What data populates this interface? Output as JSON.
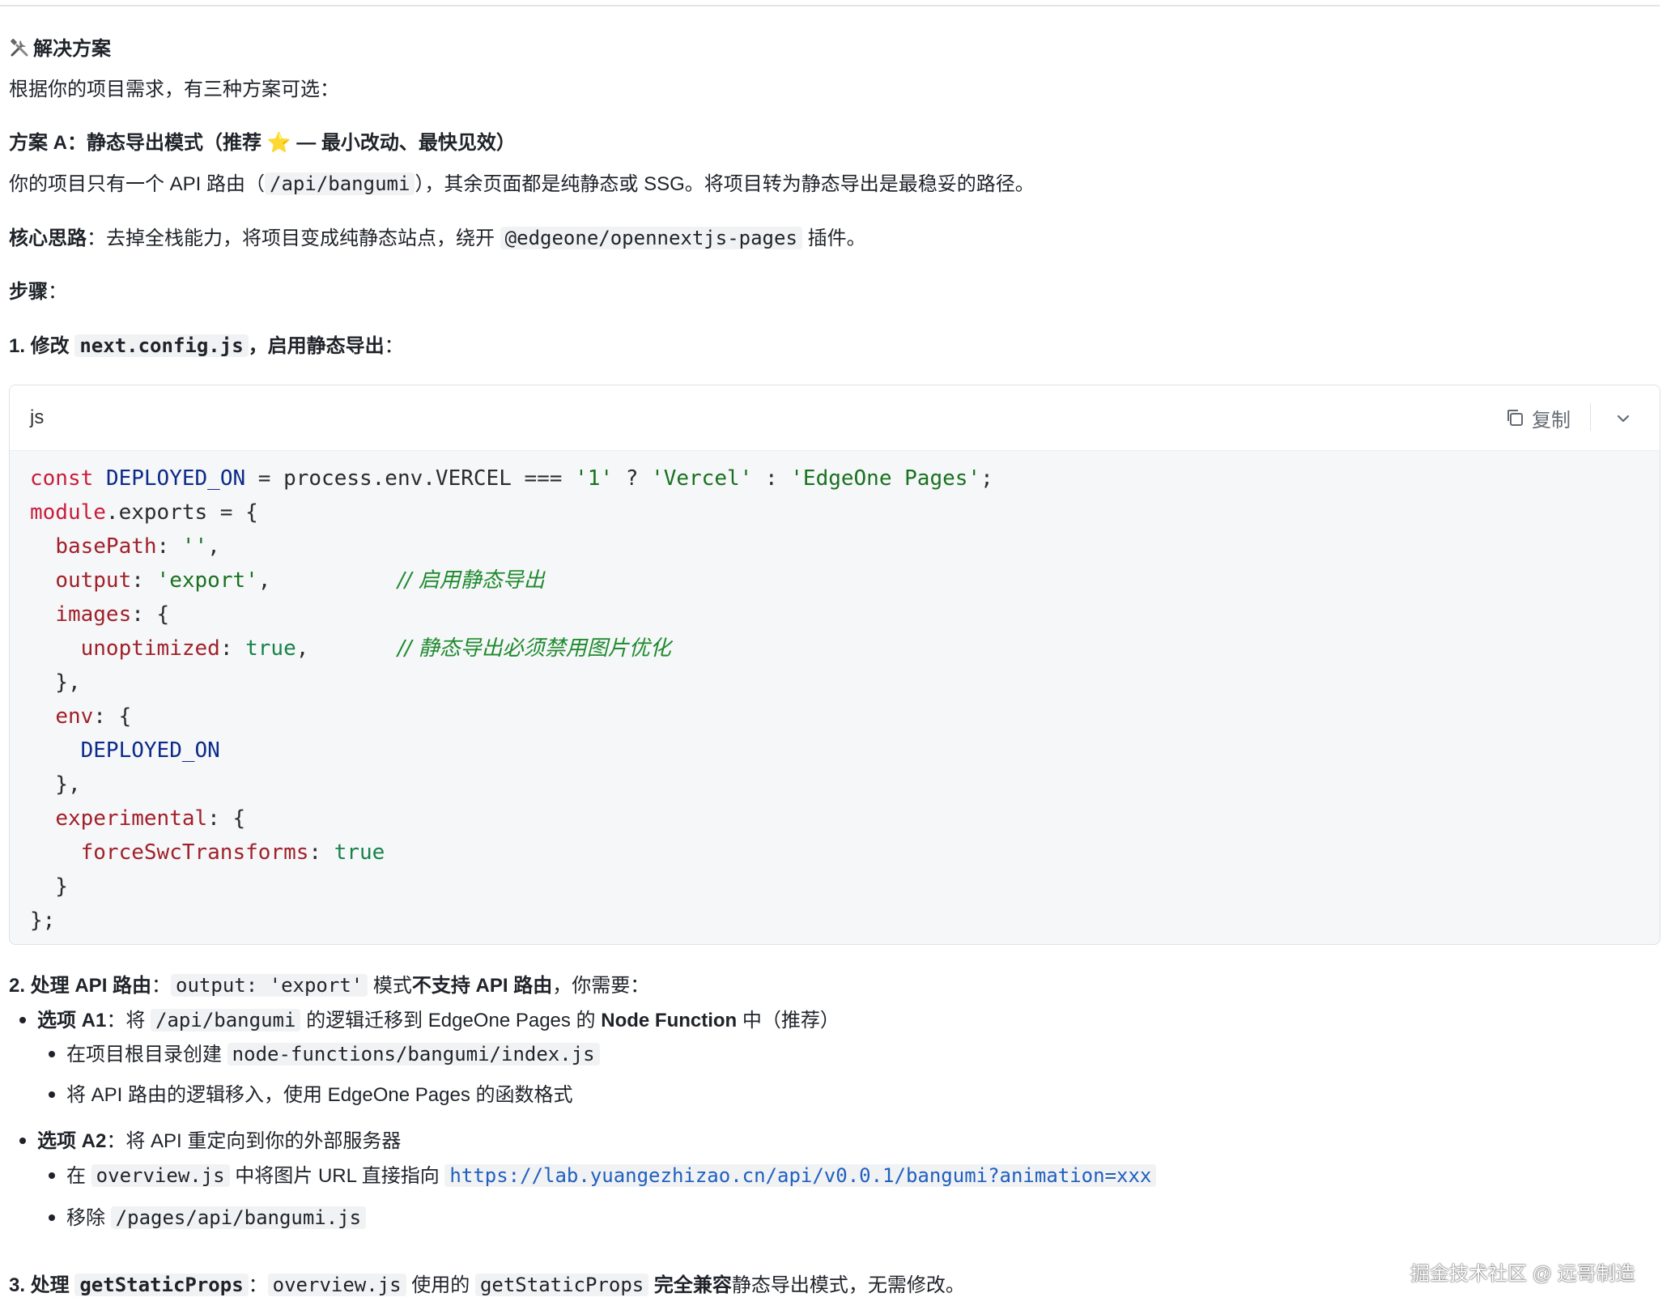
{
  "heading": {
    "icon": "tools-icon",
    "text": "解决方案"
  },
  "intro": "根据你的项目需求，有三种方案可选：",
  "planA": {
    "title": "方案 A：静态导出模式（推荐 ",
    "star": "⭐",
    "title_tail": " — 最小改动、最快见效）",
    "desc_pre": "你的项目只有一个 API 路由（",
    "desc_code": "/api/bangumi",
    "desc_post": "），其余页面都是纯静态或 SSG。将项目转为静态导出是最稳妥的路径。",
    "core_label": "核心思路",
    "core_text": "：去掉全栈能力，将项目变成纯静态站点，绕开 ",
    "core_code": "@edgeone/opennextjs-pages",
    "core_tail": " 插件。",
    "steps_label": "步骤",
    "steps_colon": "：",
    "step1_pre": "1. 修改 ",
    "step1_code": "next.config.js",
    "step1_post": "，启用静态导出",
    "step1_colon": "："
  },
  "codeblock": {
    "lang": "js",
    "copy_label": "复制",
    "comment_export": "// 启用静态导出",
    "comment_images": "// 静态导出必须禁用图片优化"
  },
  "step2": {
    "label": "2. 处理 API 路由",
    "colon": "：",
    "code": "output: 'export'",
    "mid": " 模式",
    "bold": "不支持 API 路由",
    "tail": "，你需要：",
    "a1_label": "选项 A1",
    "a1_pre": "：将 ",
    "a1_code": "/api/bangumi",
    "a1_mid": " 的逻辑迁移到 EdgeOne Pages 的 ",
    "a1_bold": "Node Function",
    "a1_tail": " 中（推荐）",
    "a1_sub1_pre": "在项目根目录创建 ",
    "a1_sub1_code": "node-functions/bangumi/index.js",
    "a1_sub2": "将 API 路由的逻辑移入，使用 EdgeOne Pages 的函数格式",
    "a2_label": "选项 A2",
    "a2_text": "：将 API 重定向到你的外部服务器",
    "a2_sub1_pre": "在 ",
    "a2_sub1_code": "overview.js",
    "a2_sub1_mid": " 中将图片 URL 直接指向 ",
    "a2_sub1_link": "https://lab.yuangezhizao.cn/api/v0.0.1/bangumi?animation=xxx",
    "a2_sub2_pre": "移除 ",
    "a2_sub2_code": "/pages/api/bangumi.js"
  },
  "step3": {
    "label": "3. 处理 ",
    "code1": "getStaticProps",
    "colon": "：",
    "code2": "overview.js",
    "mid": " 使用的 ",
    "code3": "getStaticProps",
    "bold": " 完全兼容",
    "tail": "静态导出模式，无需修改。"
  },
  "watermark": "掘金技术社区 @ 远哥制造"
}
